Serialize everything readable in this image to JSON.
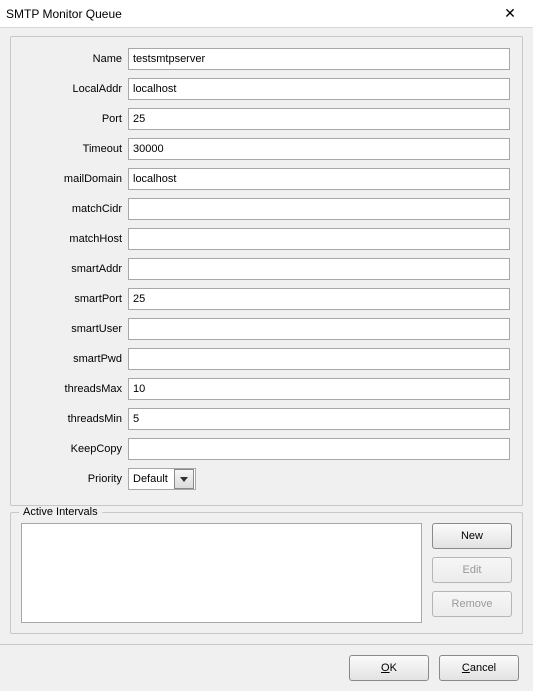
{
  "window": {
    "title": "SMTP Monitor Queue"
  },
  "form": {
    "name": {
      "label": "Name",
      "value": "testsmtpserver"
    },
    "localAddr": {
      "label": "LocalAddr",
      "value": "localhost"
    },
    "port": {
      "label": "Port",
      "value": "25"
    },
    "timeout": {
      "label": "Timeout",
      "value": "30000"
    },
    "mailDomain": {
      "label": "mailDomain",
      "value": "localhost"
    },
    "matchCidr": {
      "label": "matchCidr",
      "value": ""
    },
    "matchHost": {
      "label": "matchHost",
      "value": ""
    },
    "smartAddr": {
      "label": "smartAddr",
      "value": ""
    },
    "smartPort": {
      "label": "smartPort",
      "value": "25"
    },
    "smartUser": {
      "label": "smartUser",
      "value": ""
    },
    "smartPwd": {
      "label": "smartPwd",
      "value": ""
    },
    "threadsMax": {
      "label": "threadsMax",
      "value": "10"
    },
    "threadsMin": {
      "label": "threadsMin",
      "value": "5"
    },
    "keepCopy": {
      "label": "KeepCopy",
      "value": ""
    },
    "priority": {
      "label": "Priority",
      "value": "Default"
    }
  },
  "intervals": {
    "legend": "Active Intervals",
    "buttons": {
      "new": "New",
      "edit": "Edit",
      "remove": "Remove"
    }
  },
  "footer": {
    "ok_pre": "",
    "ok_m": "O",
    "ok_post": "K",
    "cancel_pre": "",
    "cancel_m": "C",
    "cancel_post": "ancel"
  }
}
